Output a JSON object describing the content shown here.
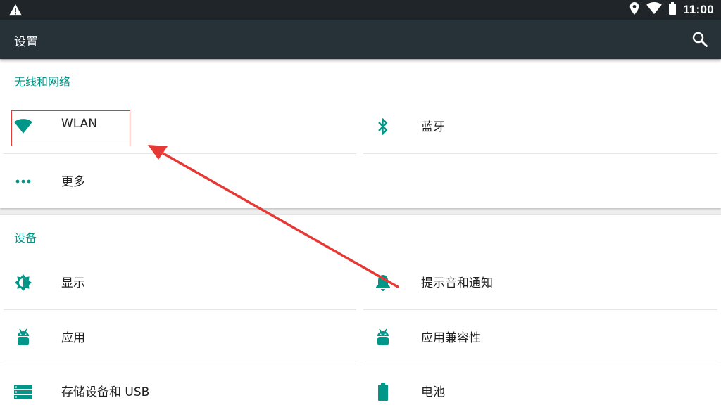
{
  "status_bar": {
    "time": "11:00",
    "icons": [
      "warning-icon",
      "location-icon",
      "wifi-signal-icon",
      "battery-icon"
    ]
  },
  "app_bar": {
    "title": "设置",
    "search_icon": "search-icon"
  },
  "sections": [
    {
      "title": "无线和网络",
      "items": [
        {
          "label": "WLAN",
          "icon": "wifi-icon"
        },
        {
          "label": "蓝牙",
          "icon": "bluetooth-icon"
        },
        {
          "label": "更多",
          "icon": "more-dots-icon"
        }
      ]
    },
    {
      "title": "设备",
      "items": [
        {
          "label": "显示",
          "icon": "brightness-icon"
        },
        {
          "label": "提示音和通知",
          "icon": "bell-icon"
        },
        {
          "label": "应用",
          "icon": "android-icon"
        },
        {
          "label": "应用兼容性",
          "icon": "android-icon"
        },
        {
          "label": "存储设备和 USB",
          "icon": "storage-icon"
        },
        {
          "label": "电池",
          "icon": "battery-icon"
        }
      ]
    }
  ],
  "colors": {
    "accent": "#009688",
    "app_bar": "#263238",
    "status_bar": "#1f2528",
    "annotation": "#e53935"
  }
}
